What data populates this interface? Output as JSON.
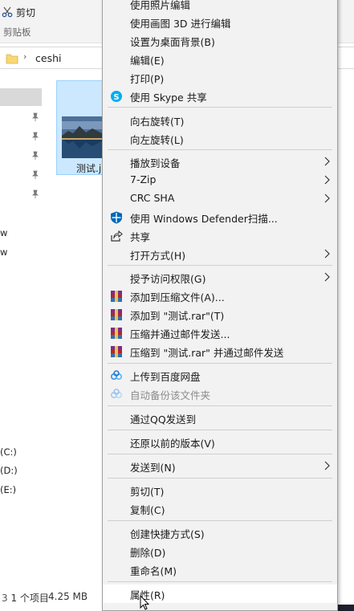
{
  "explorer": {
    "ribbon": {
      "cut_label": "剪切",
      "group_label": "剪贴板"
    },
    "address": {
      "path": "ceshi"
    },
    "nav": {
      "fragments": [
        "w",
        "w",
        "(C:)",
        "(D:)",
        "(E:)"
      ]
    },
    "file": {
      "name": "测试.j"
    },
    "status": {
      "items": "1 个项目",
      "size": "4.25 MB"
    }
  },
  "menu": {
    "items": {
      "photos_edit": "使用照片编辑",
      "paint3d_edit": "使用画图 3D 进行编辑",
      "set_background": "设置为桌面背景(B)",
      "edit": "编辑(E)",
      "print": "打印(P)",
      "skype_share": "使用 Skype 共享",
      "rotate_right": "向右旋转(T)",
      "rotate_left": "向左旋转(L)",
      "cast_to_device": "播放到设备",
      "seven_zip": "7-Zip",
      "crc_sha": "CRC SHA",
      "defender_scan": "使用 Windows Defender扫描...",
      "share": "共享",
      "open_with": "打开方式(H)",
      "give_access": "授予访问权限(G)",
      "add_to_archive": "添加到压缩文件(A)...",
      "add_to_rar": "添加到 \"测试.rar\"(T)",
      "compress_email": "压缩并通过邮件发送...",
      "compress_rar_email": "压缩到 \"测试.rar\" 并通过邮件发送",
      "upload_baidu": "上传到百度网盘",
      "auto_backup": "自动备份该文件夹",
      "send_via_qq": "通过QQ发送到",
      "restore_versions": "还原以前的版本(V)",
      "send_to": "发送到(N)",
      "cut": "剪切(T)",
      "copy": "复制(C)",
      "create_shortcut": "创建快捷方式(S)",
      "delete": "删除(D)",
      "rename": "重命名(M)",
      "properties": "属性(R)"
    }
  },
  "colors": {
    "menu_bg": "#f2f2f2",
    "menu_hover": "#ffffff",
    "selection": "#cce8ff",
    "winrar_red": "#b3262a",
    "skype_blue": "#00aff0",
    "defender_blue": "#0067b8"
  }
}
